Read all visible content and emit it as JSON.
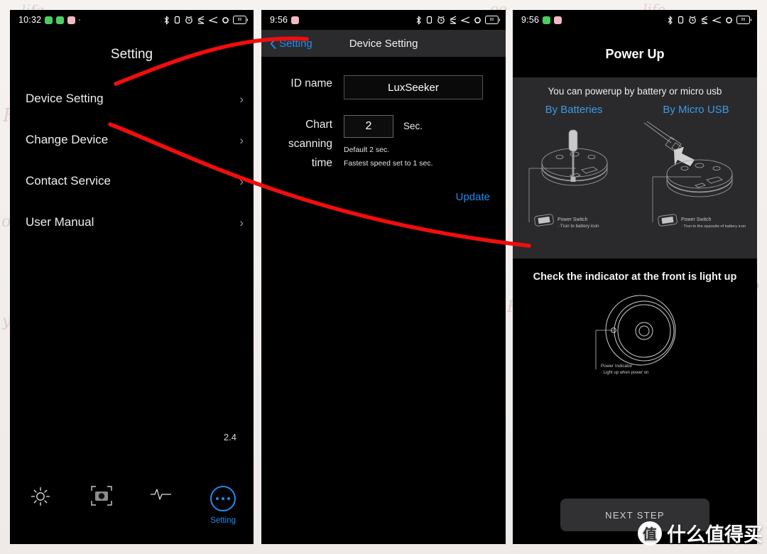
{
  "background": {
    "words": [
      "life",
      "For",
      "o",
      "y",
      "oo",
      "life",
      "F",
      "o"
    ]
  },
  "panel1": {
    "statusbar": {
      "time": "10:32",
      "icons": [
        "chat-badge",
        "plus-badge",
        "clock-badge",
        "dot"
      ],
      "right_icons": [
        "bluetooth-icon",
        "vibrate-icon",
        "alarm-icon",
        "dnd-icon",
        "signal-icon",
        "wifi-icon",
        "battery-icon"
      ],
      "battery_level": "89"
    },
    "title": "Setting",
    "menu": [
      {
        "label": "Device Setting",
        "chevron": "›"
      },
      {
        "label": "Change Device",
        "chevron": "›"
      },
      {
        "label": "Contact Service",
        "chevron": "›"
      },
      {
        "label": "User Manual",
        "chevron": "›"
      }
    ],
    "version": "2.4",
    "tabs": [
      {
        "name": "brightness-tab",
        "icon": "sun-icon",
        "label": ""
      },
      {
        "name": "camera-tab",
        "icon": "camera-icon",
        "label": ""
      },
      {
        "name": "chart-tab",
        "icon": "waveform-icon",
        "label": ""
      },
      {
        "name": "setting-tab",
        "icon": "dots-circle-icon",
        "label": "Setting"
      }
    ]
  },
  "panel2": {
    "statusbar": {
      "time": "9:56",
      "battery_level": "89"
    },
    "nav": {
      "back_label": "Setting",
      "back_icon": "chevron-left-icon",
      "title": "Device Setting"
    },
    "fields": {
      "id_name_label": "ID name",
      "id_name_value": "LuxSeeker",
      "id_name_placeholder": "ID name",
      "scan_label": "Chart scanning time",
      "scan_value": "2",
      "scan_placeholder": "2",
      "scan_unit": "Sec.",
      "hint_line1": "Default 2 sec.",
      "hint_line2": "Fastest speed set to 1 sec."
    },
    "update_label": "Update"
  },
  "panel3": {
    "statusbar": {
      "time": "9:56",
      "battery_level": "89"
    },
    "title": "Power Up",
    "subtitle": "You can powerup by battery or micro usb",
    "columns": [
      {
        "title": "By Batteries",
        "caption_title": "Power Switch",
        "caption_line": "· Trun to battery icon"
      },
      {
        "title": "By Micro USB",
        "caption_title": "Power Switch",
        "caption_line": "· Trun to the opposite of battery icon"
      }
    ],
    "check_text": "Check the indicator at the front is light up",
    "indicator_caption_title": "Power Indicator",
    "indicator_caption_line": "· Light up when power on",
    "next_button": "NEXT STEP"
  },
  "watermark": {
    "badge": "值",
    "text": "什么值得买"
  },
  "colors": {
    "accent_blue": "#1f8cf0",
    "annotation_red": "#f20d0d",
    "panel_bg": "#000000",
    "navbar_bg": "#2b2b2e"
  }
}
